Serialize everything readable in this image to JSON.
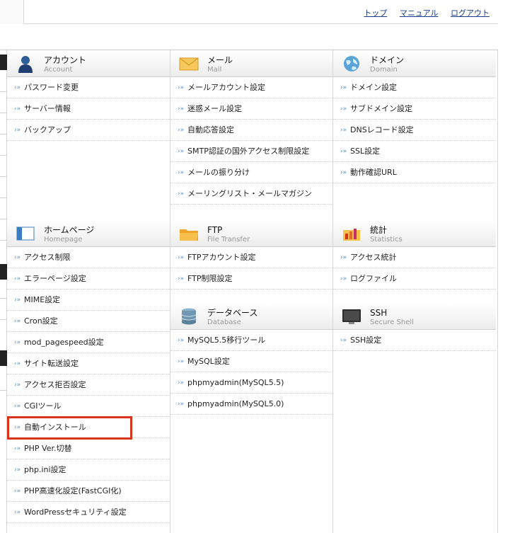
{
  "topnav": {
    "top": "トップ",
    "manual": "マニュアル",
    "logout": "ログアウト"
  },
  "logo_fragment": "l",
  "bullet": "›»",
  "sections": {
    "account": {
      "title": "アカウント",
      "subtitle": "Account",
      "items": [
        "パスワード変更",
        "サーバー情報",
        "バックアップ"
      ]
    },
    "mail": {
      "title": "メール",
      "subtitle": "Mail",
      "items": [
        "メールアカウント設定",
        "迷惑メール設定",
        "自動応答設定",
        "SMTP認証の国外アクセス制限設定",
        "メールの振り分け",
        "メーリングリスト・メールマガジン"
      ]
    },
    "domain": {
      "title": "ドメイン",
      "subtitle": "Domain",
      "items": [
        "ドメイン設定",
        "サブドメイン設定",
        "DNSレコード設定",
        "SSL設定",
        "動作確認URL"
      ]
    },
    "homepage": {
      "title": "ホームページ",
      "subtitle": "Homepage",
      "items": [
        "アクセス制限",
        "エラーページ設定",
        "MIME設定",
        "Cron設定",
        "mod_pagespeed設定",
        "サイト転送設定",
        "アクセス拒否設定",
        "CGIツール",
        "自動インストール",
        "PHP Ver.切替",
        "php.ini設定",
        "PHP高速化設定(FastCGI化)",
        "WordPressセキュリティ設定"
      ]
    },
    "ftp": {
      "title": "FTP",
      "subtitle": "File Transfer",
      "items": [
        "FTPアカウント設定",
        "FTP制限設定"
      ]
    },
    "stats": {
      "title": "統計",
      "subtitle": "Statistics",
      "items": [
        "アクセス統計",
        "ログファイル"
      ]
    },
    "database": {
      "title": "データベース",
      "subtitle": "Database",
      "items": [
        "MySQL5.5移行ツール",
        "MySQL設定",
        "phpmyadmin(MySQL5.5)",
        "phpmyadmin(MySQL5.0)"
      ]
    },
    "ssh": {
      "title": "SSH",
      "subtitle": "Secure Shell",
      "items": [
        "SSH設定"
      ]
    }
  },
  "colors": {
    "highlight": "#d9331c",
    "link": "#1a3e8c",
    "bullet": "#5a8fc8"
  }
}
